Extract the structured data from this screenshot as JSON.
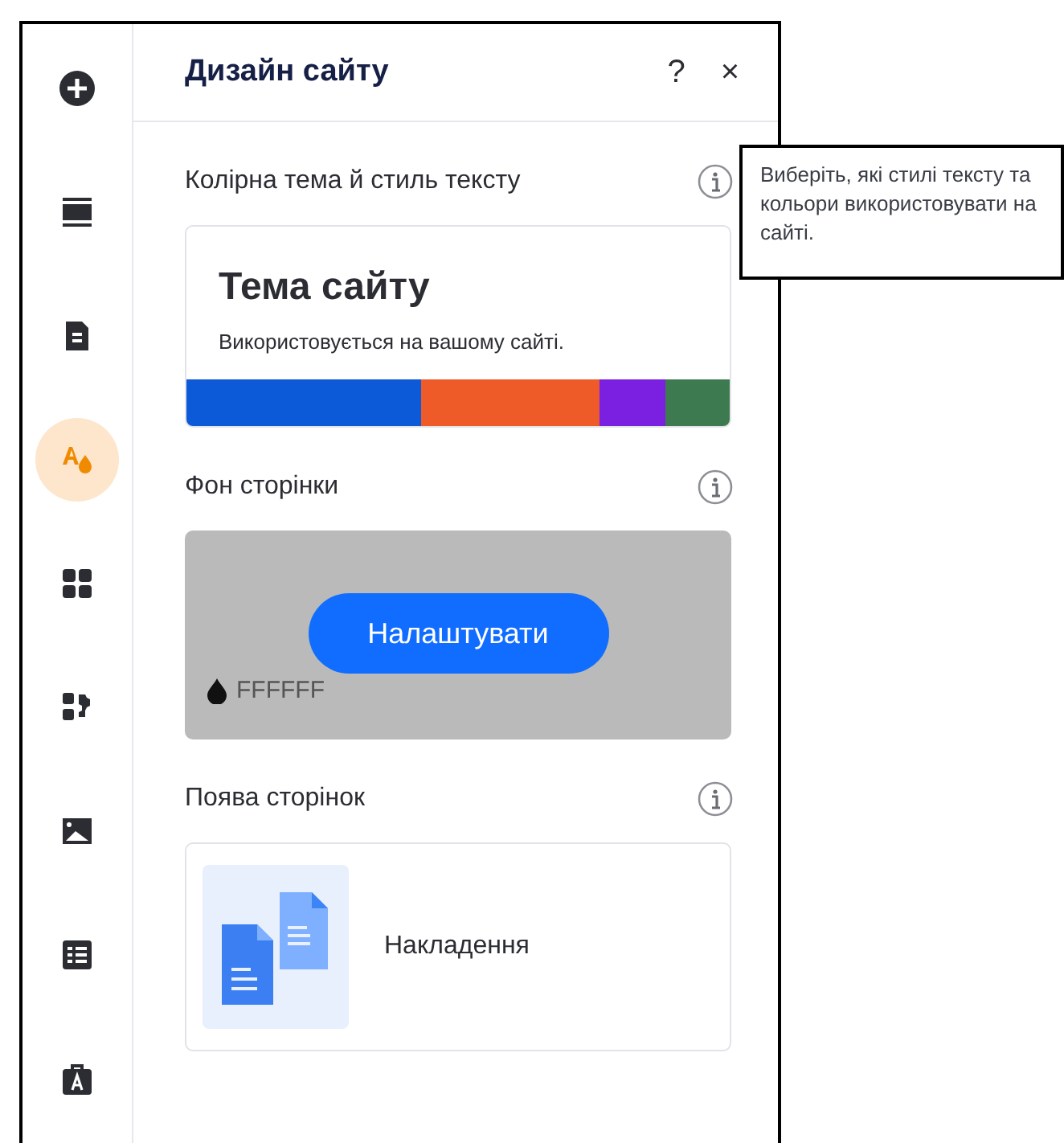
{
  "sidebar": {
    "items": [
      {
        "kind": "add",
        "selected": false
      },
      {
        "kind": "sections",
        "selected": false
      },
      {
        "kind": "pages",
        "selected": false
      },
      {
        "kind": "design",
        "selected": true
      },
      {
        "kind": "apps",
        "selected": false
      },
      {
        "kind": "business",
        "selected": false
      },
      {
        "kind": "media",
        "selected": false
      },
      {
        "kind": "cms",
        "selected": false
      },
      {
        "kind": "portfolio",
        "selected": false
      }
    ]
  },
  "panel": {
    "title": "Дизайн сайту",
    "help": "?",
    "close": "×",
    "sections": [
      {
        "kind": "theme",
        "label": "Колірна тема й стиль тексту",
        "theme_title": "Тема сайту",
        "theme_subtitle": "Використовується на вашому сайті.",
        "palette": [
          {
            "color": "#0c5ad8"
          },
          {
            "color": "#ee5a28"
          },
          {
            "color": "#7b1fe0"
          },
          {
            "color": "#3e7a50"
          }
        ]
      },
      {
        "kind": "background",
        "label": "Фон сторінки",
        "button": "Налаштувати",
        "color_code": "FFFFFF"
      },
      {
        "kind": "transition",
        "label": "Поява сторінок",
        "option": "Накладення"
      }
    ]
  },
  "tooltip": {
    "text": "Виберіть, які стилі тексту та кольори використовувати на сайті."
  }
}
